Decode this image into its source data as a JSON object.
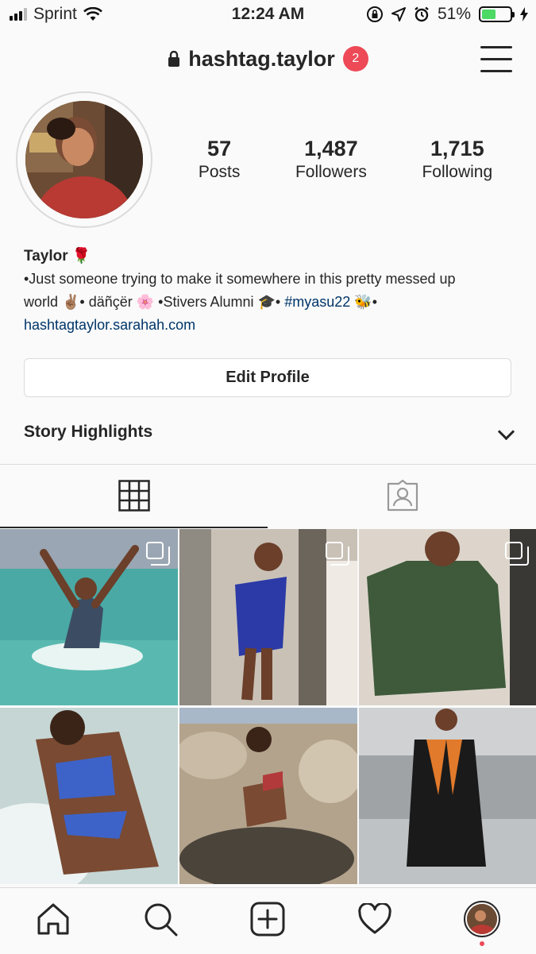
{
  "status_bar": {
    "carrier": "Sprint",
    "time": "12:24 AM",
    "battery_text": "51%",
    "battery_level": 0.51,
    "icons": [
      "signal-icon",
      "wifi-icon",
      "orientation-lock-icon",
      "location-icon",
      "alarm-icon",
      "battery-icon",
      "charging-icon"
    ]
  },
  "header": {
    "username": "hashtag.taylor",
    "notification_count": "2",
    "icons": [
      "lock-icon",
      "menu-icon"
    ]
  },
  "profile": {
    "stats": [
      {
        "value": "57",
        "label": "Posts"
      },
      {
        "value": "1,487",
        "label": "Followers"
      },
      {
        "value": "1,715",
        "label": "Following"
      }
    ],
    "name": "Taylor 🌹",
    "bio_line1": "•Just someone trying to make it somewhere in this pretty messed up",
    "bio_line2_a": "world ✌🏽• däñçër 🌸 •Stivers Alumni 🎓• ",
    "bio_hashtag": "#myasu22",
    "bio_line2_b": " 🐝•",
    "website": "hashtagtaylor.sarahah.com",
    "edit_button": "Edit Profile",
    "story_highlights": "Story Highlights"
  },
  "tabs": [
    {
      "name": "grid-view",
      "icon": "grid-icon",
      "active": true
    },
    {
      "name": "tagged",
      "icon": "tagged-person-icon",
      "active": false
    }
  ],
  "posts": [
    {
      "multi": true
    },
    {
      "multi": true
    },
    {
      "multi": true
    },
    {
      "multi": false
    },
    {
      "multi": false
    },
    {
      "multi": false
    }
  ],
  "bottom_nav": [
    "home-icon",
    "search-icon",
    "add-post-icon",
    "activity-heart-icon",
    "profile-avatar"
  ],
  "colors": {
    "accent_link": "#003569",
    "badge": "#ed4956",
    "battery": "#4cd964"
  }
}
